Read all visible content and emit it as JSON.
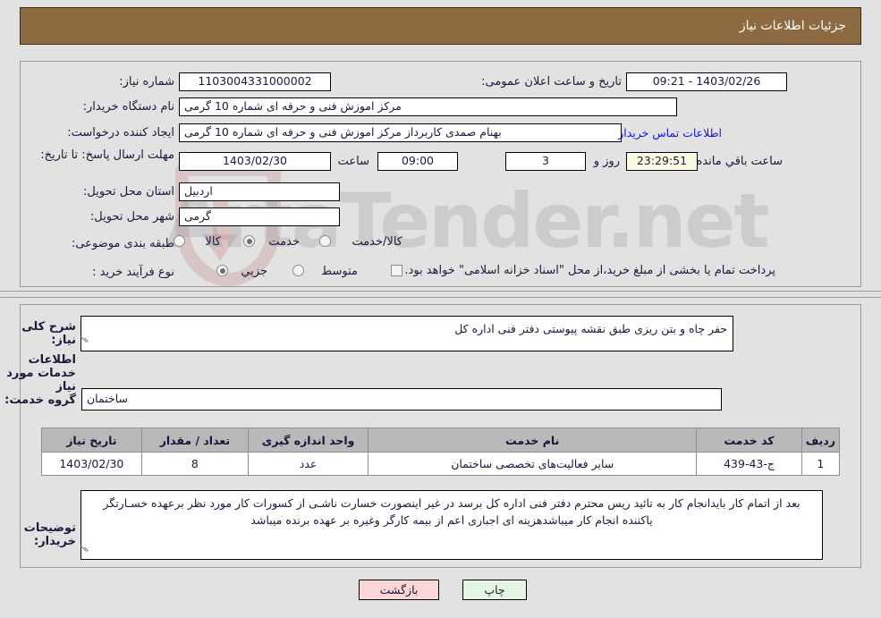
{
  "header": {
    "title": "جزئیات اطلاعات نیاز"
  },
  "form": {
    "labels": {
      "need_number": "شماره نیاز:",
      "buyer_org": "نام دستگاه خریدار:",
      "requester": "ایجاد کننده درخواست:",
      "deadline": "مهلت ارسال پاسخ: تا تاریخ:",
      "province": "استان محل تحویل:",
      "city": "شهر محل تحویل:",
      "category": "طبقه بندی موضوعی:",
      "purchase_type": "نوع فرآیند خرید :",
      "announce_datetime": "تاریخ و ساعت اعلان عمومی:",
      "hour": "ساعت",
      "day_and": "روز و",
      "remaining": "ساعت باقي مانده"
    },
    "values": {
      "need_number": "1103004331000002",
      "buyer_org": "مرکز اموزش فنی و حرفه ای شماره 10  گرمی",
      "requester": "بهنام صمدی کاربرداز مرکز اموزش فنی و حرفه ای شماره 10  گرمی",
      "deadline_date": "1403/02/30",
      "deadline_hour": "09:00",
      "days_left": "3",
      "time_left": "23:29:51",
      "province": "اردبیل",
      "city": "گرمی",
      "announce_datetime": "1403/02/26 - 09:21"
    },
    "contact_link": "اطلاعات تماس خریدار",
    "category_options": [
      {
        "label": "کالا",
        "selected": false
      },
      {
        "label": "خدمت",
        "selected": true
      },
      {
        "label": "کالا/خدمت",
        "selected": false
      }
    ],
    "purchase_options": [
      {
        "label": "جزیي",
        "selected": true
      },
      {
        "label": "متوسط",
        "selected": false
      }
    ],
    "treasury_checkbox": {
      "checked": false,
      "label": "پرداخت تمام یا بخشی از مبلغ خرید،از محل \"اسناد خزانه اسلامی\" خواهد بود."
    }
  },
  "details": {
    "general_description_label": "شرح کلی نیاز:",
    "general_description_value": "حفر چاه و بتن ریزی طبق نقشه پیوستی دفتر فنی اداره کل",
    "services_section_title": "اطلاعات خدمات مورد نیاز",
    "service_group_label": "گروه خدمت:",
    "service_group_value": "ساختمان",
    "buyer_notes_label": "توضیحات خریدار:",
    "buyer_notes_value": "بعد از اتمام کار بایدانجام کار  به تائید ریس محترم دفتر فنی اداره کل برسد در غیر اینصورت خسارت ناشـی از کسورات کار مورد نظر برعهده خسـارتگر یاکننده انجام کار میباشدهزینه ای اجباری اعم از بیمه کارگر وغیره بر عهده برنده میباشد"
  },
  "table": {
    "headers": [
      "ردیف",
      "کد خدمت",
      "نام خدمت",
      "واحد اندازه گیری",
      "تعداد / مقدار",
      "تاریخ نیاز"
    ],
    "rows": [
      [
        "1",
        "ج-43-439",
        "سایر فعالیت‌های تخصصی ساختمان",
        "عدد",
        "8",
        "1403/02/30"
      ]
    ]
  },
  "buttons": {
    "print": "چاپ",
    "back": "بازگشت"
  },
  "watermark": {
    "text": "ArtaTender.net"
  },
  "colors": {
    "header_bg": "#8d6a42",
    "page_bg": "#e2e2e2",
    "link": "#1414e6",
    "table_header_bg": "#b9b9b9",
    "print_btn_bg": "#e4f6e2",
    "back_btn_bg": "#fbd6d6",
    "highlight_field_bg": "#fbfbe3"
  }
}
